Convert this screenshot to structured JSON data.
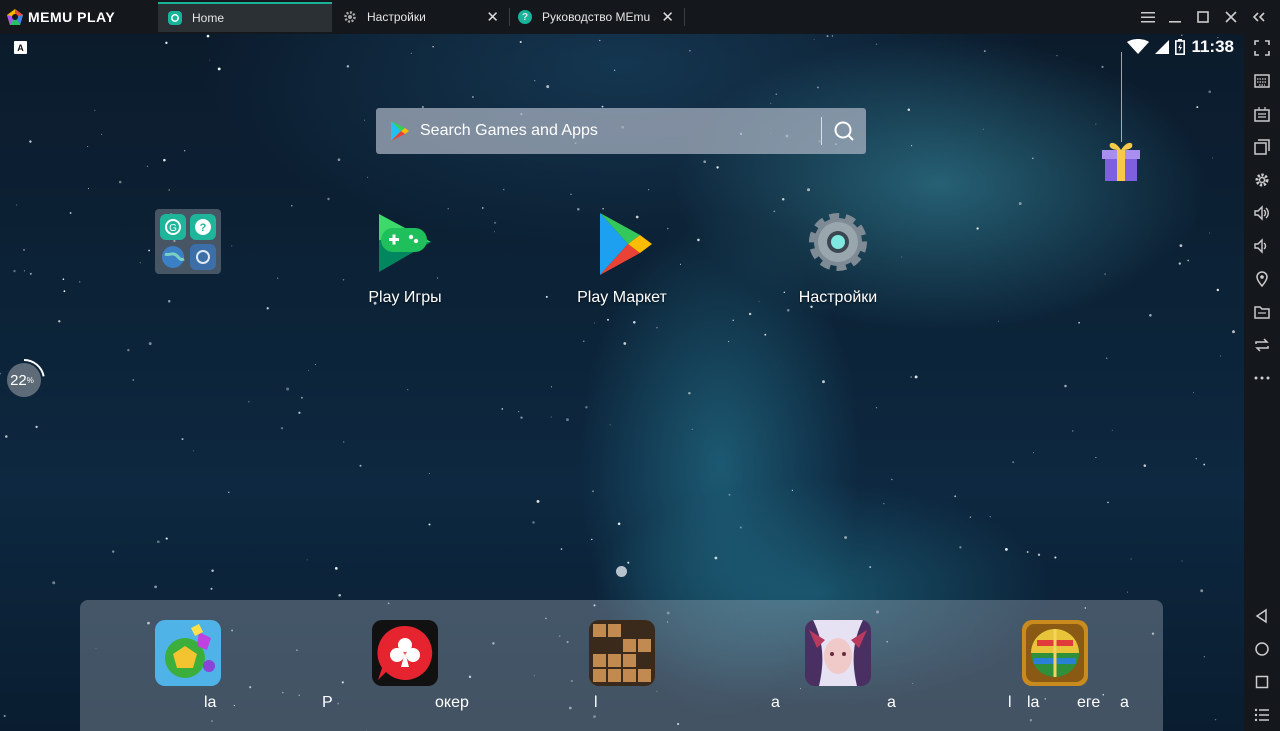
{
  "app": {
    "brand": "MEMU PLAY"
  },
  "tabs": [
    {
      "label": "Home",
      "active": true
    },
    {
      "label": "Настройки",
      "active": false
    },
    {
      "label": "Руководство MEmu",
      "active": false
    }
  ],
  "status": {
    "keyboard_badge": "A",
    "time": "11:38"
  },
  "search": {
    "placeholder": "Search Games and Apps"
  },
  "desktop_apps": [
    {
      "label": "Play Игры"
    },
    {
      "label": "Play Маркет"
    },
    {
      "label": "Настройки"
    }
  ],
  "progress": {
    "value": "22",
    "unit": "%",
    "fraction": 0.22
  },
  "dock": {
    "labels": [
      "la",
      "P",
      "окер",
      "l",
      "a",
      "a",
      "l",
      "la",
      "еге",
      "a"
    ]
  },
  "colors": {
    "accent": "#19b39a",
    "titlebar": "#14171b"
  },
  "sidebar_icons": [
    "fullscreen-icon",
    "keyboard-icon",
    "screenshot-icon",
    "multi-window-icon",
    "settings-icon",
    "volume-up-icon",
    "volume-down-icon",
    "location-icon",
    "folder-icon",
    "sync-icon",
    "more-icon",
    "back-icon",
    "home-icon",
    "recents-icon",
    "menu-icon"
  ]
}
